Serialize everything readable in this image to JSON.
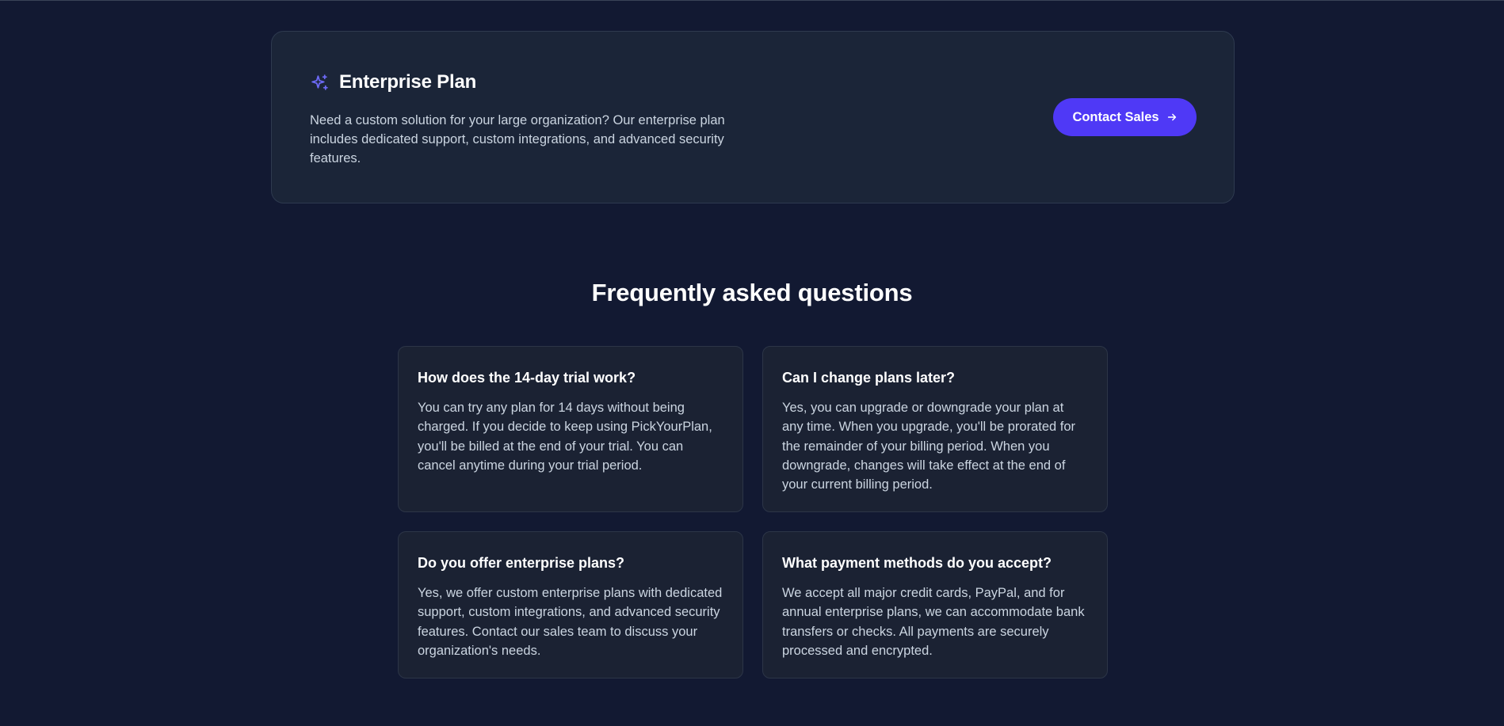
{
  "enterprise": {
    "title": "Enterprise Plan",
    "icon": "sparkles-icon",
    "description": "Need a custom solution for your large organization? Our enterprise plan includes dedicated support, custom integrations, and advanced security features.",
    "cta_label": "Contact Sales",
    "cta_icon": "arrow-right-icon",
    "accent_color": "#4f39f6"
  },
  "faq": {
    "heading": "Frequently asked questions",
    "items": [
      {
        "question": "How does the 14-day trial work?",
        "answer": "You can try any plan for 14 days without being charged. If you decide to keep using PickYourPlan, you'll be billed at the end of your trial. You can cancel anytime during your trial period."
      },
      {
        "question": "Can I change plans later?",
        "answer": "Yes, you can upgrade or downgrade your plan at any time. When you upgrade, you'll be prorated for the remainder of your billing period. When you downgrade, changes will take effect at the end of your current billing period."
      },
      {
        "question": "Do you offer enterprise plans?",
        "answer": "Yes, we offer custom enterprise plans with dedicated support, custom integrations, and advanced security features. Contact our sales team to discuss your organization's needs."
      },
      {
        "question": "What payment methods do you accept?",
        "answer": "We accept all major credit cards, PayPal, and for annual enterprise plans, we can accommodate bank transfers or checks. All payments are securely processed and encrypted."
      }
    ]
  }
}
